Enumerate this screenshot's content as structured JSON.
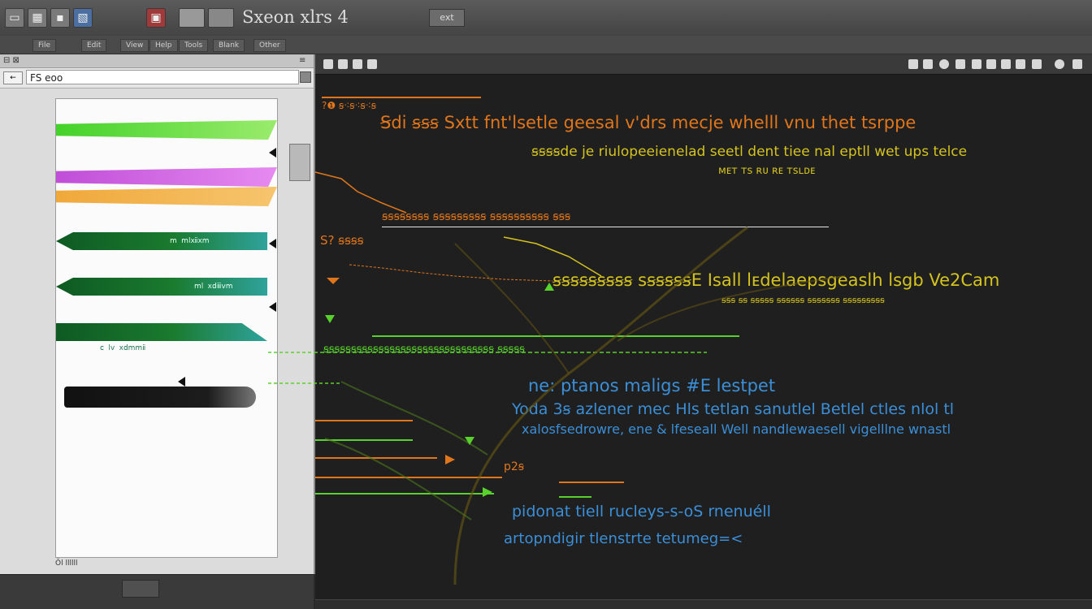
{
  "title_bar": {
    "title": "Sxeon xlrs 4",
    "badge": "ext",
    "icon_glyphs": [
      "▭",
      "▦",
      "▪",
      "▧",
      "▣"
    ]
  },
  "menubar": {
    "items": [
      "File",
      "Edit",
      "View",
      "Help",
      "Tools",
      "Blank",
      "Other"
    ]
  },
  "left_panel": {
    "header_left": "⊟ ⊠",
    "header_right": "≡",
    "nav_button": "←",
    "search_value": "FS eoo",
    "strip_labels": [
      "ⅿ ⅿⅼⅻⅹⅿ",
      "ⅿⅼ ⅹⅾⅲⅴⅿ",
      "ⅽ ⅼⅴ ⅹⅾⅿⅿⅱ"
    ],
    "footer_text": "Ǒl ⅼⅼⅼⅼⅼⅼ"
  },
  "right_panel": {
    "lines": [
      {
        "text": "?❶ ꞩ⁖ꞩ⁖ꞩ⁖ꞩ",
        "color": "orange"
      },
      {
        "text": "Ꞩdi ꞩꞩꞩ Sxtt fnt'lsetle geesal v'drs mecje whelll vnu thet tsrppe",
        "color": "orange"
      },
      {
        "text": "ꞩꞩꞩꞩde je riulopeeienelad seetl dent tiee nal eptll wet ups telce",
        "color": "yellow"
      },
      {
        "text": "ᴍᴇᴛ ᴛꜱ ʀᴜ ʀᴇ ᴛꜱʟᴅᴇ",
        "color": "yellow"
      },
      {
        "text": "ꞩꞩꞩꞩꞩꞩꞩꞩ ꞩꞩꞩꞩꞩꞩꞩꞩꞩ ꞩꞩꞩꞩꞩꞩꞩꞩꞩꞩ ꞩꞩꞩ",
        "color": "orange"
      },
      {
        "text": "S? ꞩꞩꞩꞩ",
        "color": "orange"
      },
      {
        "text": "ꞩꞩꞩꞩꞩꞩꞩꞩꞩ sꞩꞩꞩꞩꞩE Isall lᴇdelaepsgeaslh lsgb Ve2Cam",
        "color": "yellow"
      },
      {
        "text": "ꞩꞩꞩ ꞩꞩ ꞩꞩꞩꞩꞩ ꞩꞩꞩꞩꞩꞩ ꞩꞩꞩꞩꞩꞩꞩ ꞩꞩꞩꞩꞩꞩꞩꞩꞩ",
        "color": "yellow"
      },
      {
        "text": "ꞩꞩꞩꞩꞩꞩꞩꞩꞩꞩꞩꞩꞩꞩꞩꞩꞩꞩꞩꞩꞩꞩꞩꞩꞩꞩꞩꞩꞩꞩꞩ ꞩꞩꞩꞩꞩ",
        "color": "green"
      },
      {
        "text": "ne: ptanos maligs #E lestpet",
        "color": "blue"
      },
      {
        "text": "Yoda 3ꞩ azlener mec Hls tetlan sanutlel Betlel ctles nlol tl",
        "color": "blue"
      },
      {
        "text": "xalosfsedrowre, ene & lfeseall Well nandlewaesell vigelllne wnastl",
        "color": "blue"
      },
      {
        "text": "p2ꞩ",
        "color": "orange"
      },
      {
        "text": "pidonat tiell rucleys-s-oS rnenuéll",
        "color": "blue"
      },
      {
        "text": "artopndigir tlenstrte tetumeg=<",
        "color": "blue"
      }
    ]
  },
  "colors": {
    "accent_orange": "#e0761c",
    "accent_yellow": "#d4c31f",
    "accent_green": "#58d12d",
    "accent_blue": "#3b8fd8",
    "dark_bg": "#1f1f1f",
    "light_panel": "#dcdcdc"
  }
}
